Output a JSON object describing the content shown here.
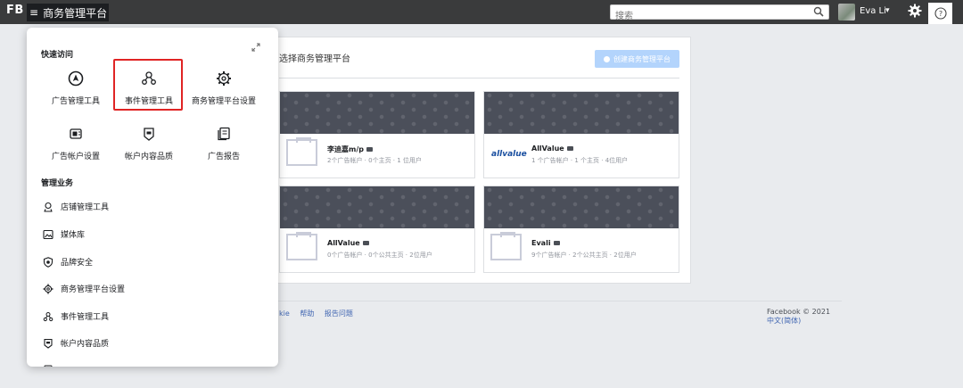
{
  "topbar": {
    "brand": "FB",
    "menu_icon": "≡",
    "menu_label": "商务管理平台",
    "search_placeholder": "搜索",
    "user_name": "Eva Li",
    "caret": "▾"
  },
  "panel": {
    "title": "选择商务管理平台",
    "create_button": "创建商务管理平台",
    "cards": [
      {
        "name": "李迪嘉m/p",
        "meta": "2个广告帐户 · 0个主页 · 1 位用户",
        "logo": ""
      },
      {
        "name": "AllValue",
        "meta": "1 个广告帐户 · 1 个主页 · 4位用户",
        "logo": "allvalue"
      },
      {
        "name": "AllValue",
        "meta": "0个广告帐户 · 0个公共主页 · 2位用户",
        "logo": ""
      },
      {
        "name": "Evali",
        "meta": "9个广告帐户 · 2个公共主页 · 2位用户",
        "logo": ""
      }
    ]
  },
  "footer": {
    "links": [
      "kie",
      "帮助",
      "报告问题"
    ],
    "copyright": "Facebook © 2021",
    "language": "中文(简体)"
  },
  "dropdown": {
    "quick_access_heading": "快速访问",
    "tiles": [
      {
        "label": "广告管理工具",
        "icon": "navigation-icon"
      },
      {
        "label": "事件管理工具",
        "icon": "events-manager-icon"
      },
      {
        "label": "商务管理平台设置",
        "icon": "gear-icon"
      },
      {
        "label": "广告帐户设置",
        "icon": "ad-account-icon"
      },
      {
        "label": "帐户内容品质",
        "icon": "shield-icon"
      },
      {
        "label": "广告报告",
        "icon": "report-icon"
      }
    ],
    "manage_heading": "管理业务",
    "items": [
      {
        "label": "店铺管理工具",
        "icon": "store-icon"
      },
      {
        "label": "媒体库",
        "icon": "media-library-icon"
      },
      {
        "label": "品牌安全",
        "icon": "brand-safety-icon"
      },
      {
        "label": "商务管理平台设置",
        "icon": "gear-icon"
      },
      {
        "label": "事件管理工具",
        "icon": "events-manager-icon"
      },
      {
        "label": "帐户内容品质",
        "icon": "shield-icon"
      }
    ]
  }
}
